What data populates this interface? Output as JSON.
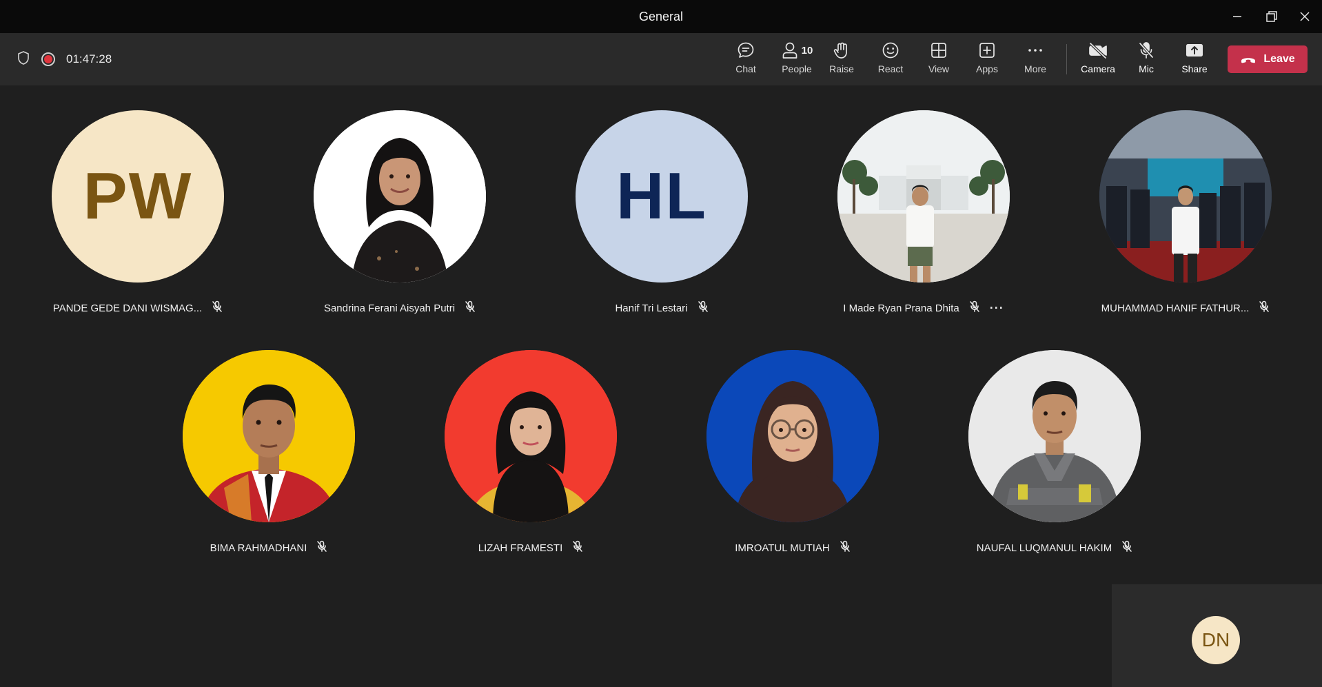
{
  "window": {
    "title": "General"
  },
  "toolbar": {
    "timer": "01:47:28",
    "chat_label": "Chat",
    "people_label": "People",
    "people_count": "10",
    "raise_label": "Raise",
    "react_label": "React",
    "view_label": "View",
    "apps_label": "Apps",
    "more_label": "More",
    "camera_label": "Camera",
    "mic_label": "Mic",
    "share_label": "Share",
    "leave_label": "Leave",
    "leave_color": "#c4314b"
  },
  "participants": [
    {
      "name": "PANDE GEDE DANI WISMAG...",
      "initials": "PW",
      "avatar_type": "initials",
      "bg": "#f6e6c6",
      "fg": "#7a5512",
      "muted": true
    },
    {
      "name": "Sandrina Ferani Aisyah Putri",
      "avatar_type": "photo",
      "bg": "#ffffff",
      "muted": true
    },
    {
      "name": "Hanif Tri Lestari",
      "initials": "HL",
      "avatar_type": "initials",
      "bg": "#c7d4e8",
      "fg": "#0e2556",
      "muted": true
    },
    {
      "name": "I Made Ryan Prana Dhita",
      "avatar_type": "photo",
      "bg": "#e9ecec",
      "muted": true,
      "more": true
    },
    {
      "name": "MUHAMMAD HANIF FATHUR...",
      "avatar_type": "photo",
      "bg": "#2a3c5a",
      "muted": true
    },
    {
      "name": "BIMA RAHMADHANI",
      "avatar_type": "photo",
      "bg": "#f5c800",
      "muted": true
    },
    {
      "name": "LIZAH FRAMESTI",
      "avatar_type": "photo",
      "bg": "#f03a2e",
      "muted": true
    },
    {
      "name": "IMROATUL MUTIAH",
      "avatar_type": "photo",
      "bg": "#0a47b8",
      "muted": true
    },
    {
      "name": "NAUFAL LUQMANUL HAKIM",
      "avatar_type": "photo",
      "bg": "#e8e8e8",
      "muted": true
    }
  ],
  "self_view": {
    "initials": "DN"
  },
  "more_dots": "···"
}
